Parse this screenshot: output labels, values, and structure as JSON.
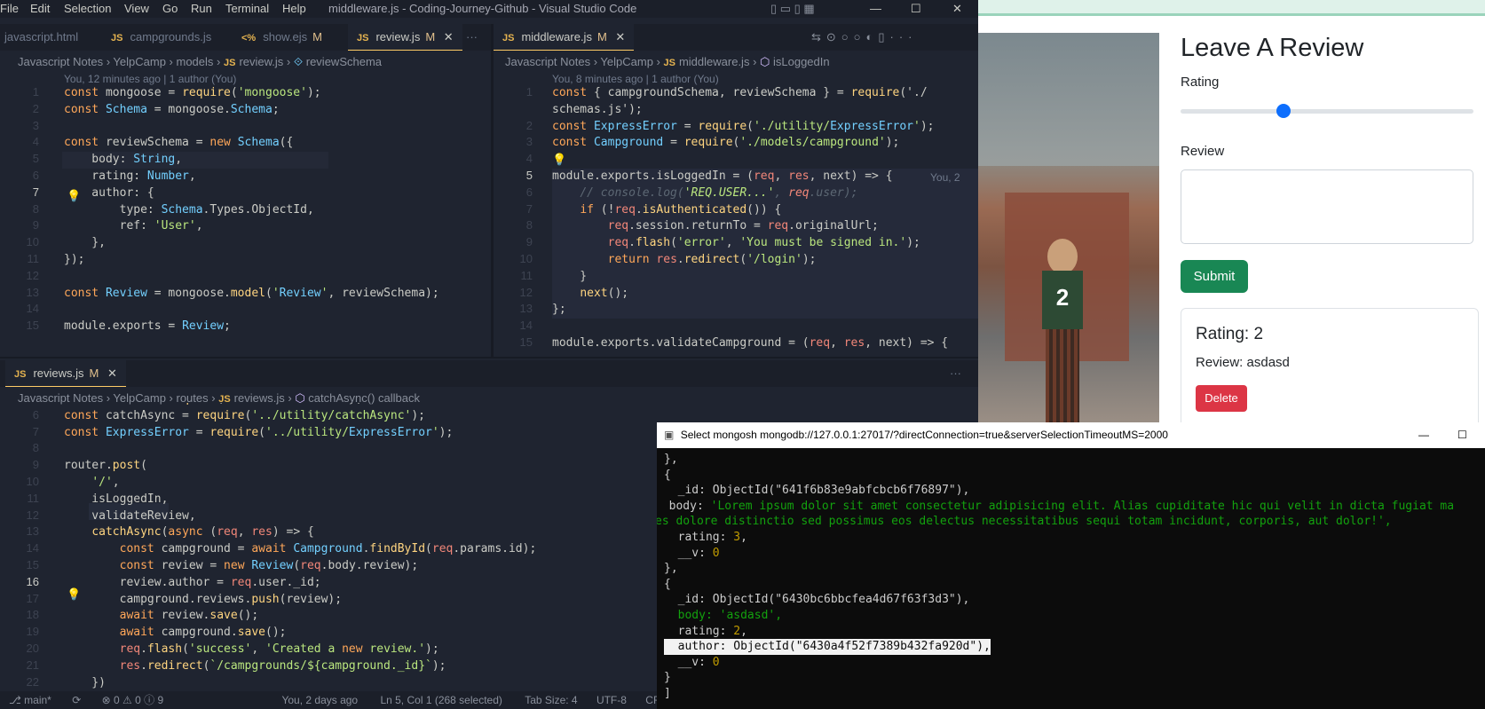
{
  "vscode": {
    "menu": [
      "File",
      "Edit",
      "Selection",
      "View",
      "Go",
      "Run",
      "Terminal",
      "Help"
    ],
    "window_title": "middleware.js - Coding-Journey-Github - Visual Studio Code",
    "left_tabs": [
      {
        "label": "javascript.html"
      },
      {
        "label": "campgrounds.js",
        "badge": "JS"
      },
      {
        "label": "show.ejs",
        "badge": "<%",
        "status": "M"
      },
      {
        "label": "review.js",
        "badge": "JS",
        "status": "M"
      }
    ],
    "right_tabs": [
      {
        "label": "middleware.js",
        "badge": "JS",
        "status": "M"
      }
    ],
    "left_breadcrumb": [
      "Javascript Notes",
      "YelpCamp",
      "models",
      "review.js",
      "reviewSchema"
    ],
    "left_blame": "You, 12 minutes ago | 1 author (You)",
    "right_breadcrumb": [
      "Javascript Notes",
      "YelpCamp",
      "middleware.js",
      "isLoggedIn"
    ],
    "right_blame": "You, 8 minutes ago | 1 author (You)",
    "right_inline_blame": "You, 2",
    "bottom_tab": {
      "label": "reviews.js",
      "badge": "JS",
      "status": "M"
    },
    "bottom_breadcrumb": [
      "Javascript Notes",
      "YelpCamp",
      "routes",
      "reviews.js",
      "catchAsync() callback"
    ],
    "left_code_lines": [
      "1",
      "2",
      "3",
      "4",
      "5",
      "6",
      "7",
      "8",
      "9",
      "10",
      "11",
      "12",
      "13",
      "14",
      "15"
    ],
    "right_code_lines": [
      "1",
      "",
      "2",
      "3",
      "4",
      "5",
      "6",
      "7",
      "8",
      "9",
      "10",
      "11",
      "12",
      "13",
      "14",
      "15"
    ],
    "bottom_code_lines": [
      "5",
      "6",
      "7",
      "8",
      "9",
      "10",
      "11",
      "12",
      "13",
      "14",
      "15",
      "16",
      "17",
      "18",
      "19",
      "20",
      "21",
      "22"
    ],
    "left_code": [
      "const mongoose = require('mongoose');",
      "const Schema = mongoose.Schema;",
      "",
      "const reviewSchema = new Schema({",
      "    body: String,",
      "    rating: Number,",
      "    author: {",
      "        type: Schema.Types.ObjectId,",
      "        ref: 'User',",
      "    },",
      "});",
      "",
      "const Review = mongoose.model('Review', reviewSchema);",
      "",
      "module.exports = Review;"
    ],
    "right_code": [
      "const { campgroundSchema, reviewSchema } = require('./",
      "schemas.js');",
      "const ExpressError = require('./utility/ExpressError');",
      "const Campground = require('./models/campground');",
      "",
      "module.exports.isLoggedIn = (req, res, next) => {",
      "    // console.log('REQ.USER...', req.user);",
      "    if (!req.isAuthenticated()) {",
      "        req.session.returnTo = req.originalUrl;",
      "        req.flash('error', 'You must be signed in.');",
      "        return res.redirect('/login');",
      "    }",
      "    next();",
      "};",
      "",
      "module.exports.validateCampground = (req, res, next) => {"
    ],
    "bottom_code": [
      "const Review = require('../models/review');",
      "const catchAsync = require('../utility/catchAsync');",
      "const ExpressError = require('../utility/ExpressError');",
      "",
      "router.post(",
      "    '/',",
      "    isLoggedIn,",
      "    validateReview,",
      "    catchAsync(async (req, res) => {",
      "        const campground = await Campground.findById(req.params.id);",
      "        const review = new Review(req.body.review);",
      "        review.author = req.user._id;",
      "        campground.reviews.push(review);",
      "        await review.save();",
      "        await campground.save();",
      "        req.flash('success', 'Created a new review.');",
      "        res.redirect(`/campgrounds/${campground._id}`);",
      "    })"
    ],
    "status": {
      "branch": "main*",
      "problems": "⊗ 0 ⚠ 0 ⓘ 9",
      "blame": "You, 2 days ago",
      "position": "Ln 5, Col 1 (268 selected)",
      "spaces": "Tab Size: 4",
      "encoding": "UTF-8",
      "eol": "CRLF"
    }
  },
  "web": {
    "heading": "Leave A Review",
    "rating_label": "Rating",
    "review_label": "Review",
    "submit": "Submit",
    "card_title": "Rating: 2",
    "card_review": "Review: asdasd",
    "delete": "Delete",
    "slider_value": 0.35,
    "accent": "#0d6efd",
    "submit_color": "#198754",
    "delete_color": "#dc3545"
  },
  "terminal": {
    "title": "Select mongosh mongodb://127.0.0.1:27017/?directConnection=true&serverSelectionTimeoutMS=2000",
    "lines": [
      "},",
      "{",
      "  _id: ObjectId(\"641f6b83e9abfcbcb6f76897\"),",
      "  body: 'Lorem ipsum dolor sit amet consectetur adipisicing elit. Alias cupiditate hic qui velit in dicta fugiat ma",
      "es dolore distinctio sed possimus eos delectus necessitatibus sequi totam incidunt, corporis, aut dolor!',",
      "  rating: 3,",
      "  __v: 0",
      "},",
      "{",
      "  _id: ObjectId(\"6430bc6bbcfea4d67f63f3d3\"),",
      "  body: 'asdasd',",
      "  rating: 2,",
      "  author: ObjectId(\"6430a4f52f7389b432fa920d\"),",
      "  __v: 0",
      "}",
      "]"
    ]
  }
}
